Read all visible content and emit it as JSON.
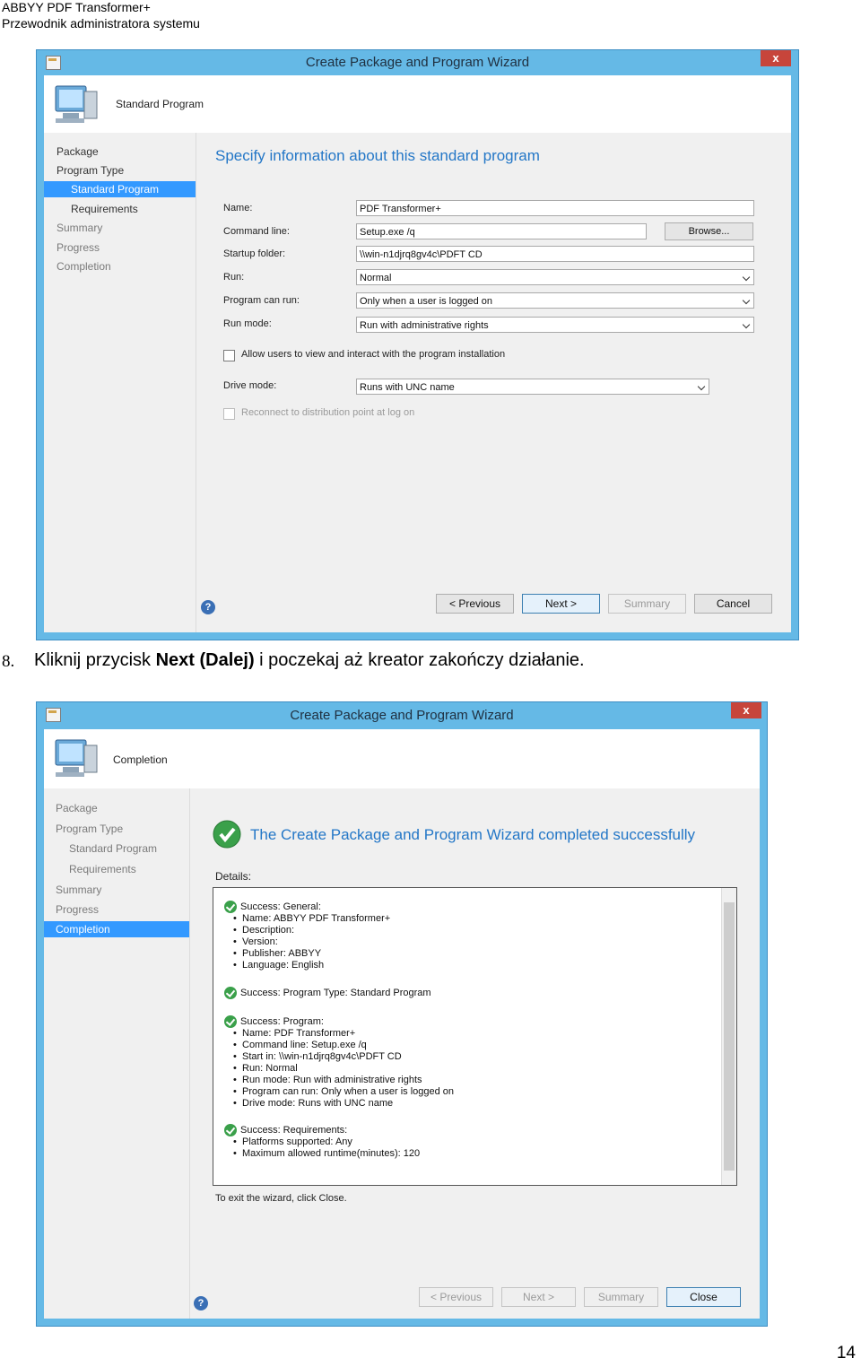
{
  "header": {
    "line1": "ABBYY PDF Transformer+",
    "line2": "Przewodnik administratora systemu"
  },
  "wizard1": {
    "title": "Create Package and Program Wizard",
    "close": "x",
    "banner_title": "Standard Program",
    "nav": [
      "Package",
      "Program Type",
      "Standard Program",
      "Requirements",
      "Summary",
      "Progress",
      "Completion"
    ],
    "heading": "Specify information about this standard program",
    "labels": {
      "name": "Name:",
      "command": "Command line:",
      "startup": "Startup folder:",
      "run": "Run:",
      "can_run": "Program can run:",
      "run_mode": "Run mode:",
      "drive": "Drive mode:"
    },
    "values": {
      "name": "PDF Transformer+",
      "command": "Setup.exe /q",
      "startup": "\\\\win-n1djrq8gv4c\\PDFT CD",
      "run": "Normal",
      "can_run": "Only when a user is logged on",
      "run_mode": "Run with administrative rights",
      "drive": "Runs with UNC name"
    },
    "browse": "Browse...",
    "checkbox1": "Allow users to view and interact with the program installation",
    "checkbox2": "Reconnect to distribution point at log on",
    "buttons": {
      "prev": "< Previous",
      "next": "Next >",
      "summary": "Summary",
      "cancel": "Cancel"
    },
    "help": "?"
  },
  "step": {
    "number": "8.",
    "text_before": "Kliknij przycisk ",
    "bold": "Next (Dalej)",
    "text_after": " i poczekaj aż kreator zakończy działanie."
  },
  "wizard2": {
    "title": "Create Package and Program Wizard",
    "close": "x",
    "banner_title": "Completion",
    "nav": [
      "Package",
      "Program Type",
      "Standard Program",
      "Requirements",
      "Summary",
      "Progress",
      "Completion"
    ],
    "heading": "The Create Package and Program Wizard completed successfully",
    "details_label": "Details:",
    "groups": [
      {
        "title": "Success: General:",
        "items": [
          "Name: ABBYY PDF Transformer+",
          "Description:",
          "Version:",
          "Publisher: ABBYY",
          "Language: English"
        ]
      },
      {
        "title": "Success: Program Type: Standard Program",
        "items": []
      },
      {
        "title": "Success: Program:",
        "items": [
          "Name: PDF Transformer+",
          "Command line: Setup.exe /q",
          "Start in: \\\\win-n1djrq8gv4c\\PDFT CD",
          "Run: Normal",
          "Run mode: Run with administrative rights",
          "Program can run: Only when a user is logged on",
          "Drive mode: Runs with UNC name"
        ]
      },
      {
        "title": "Success: Requirements:",
        "items": [
          "Platforms supported: Any",
          "Maximum allowed runtime(minutes): 120"
        ]
      }
    ],
    "exit_text": "To exit the wizard, click Close.",
    "buttons": {
      "prev": "< Previous",
      "next": "Next >",
      "summary": "Summary",
      "close": "Close"
    },
    "help": "?"
  },
  "page_number": "14"
}
